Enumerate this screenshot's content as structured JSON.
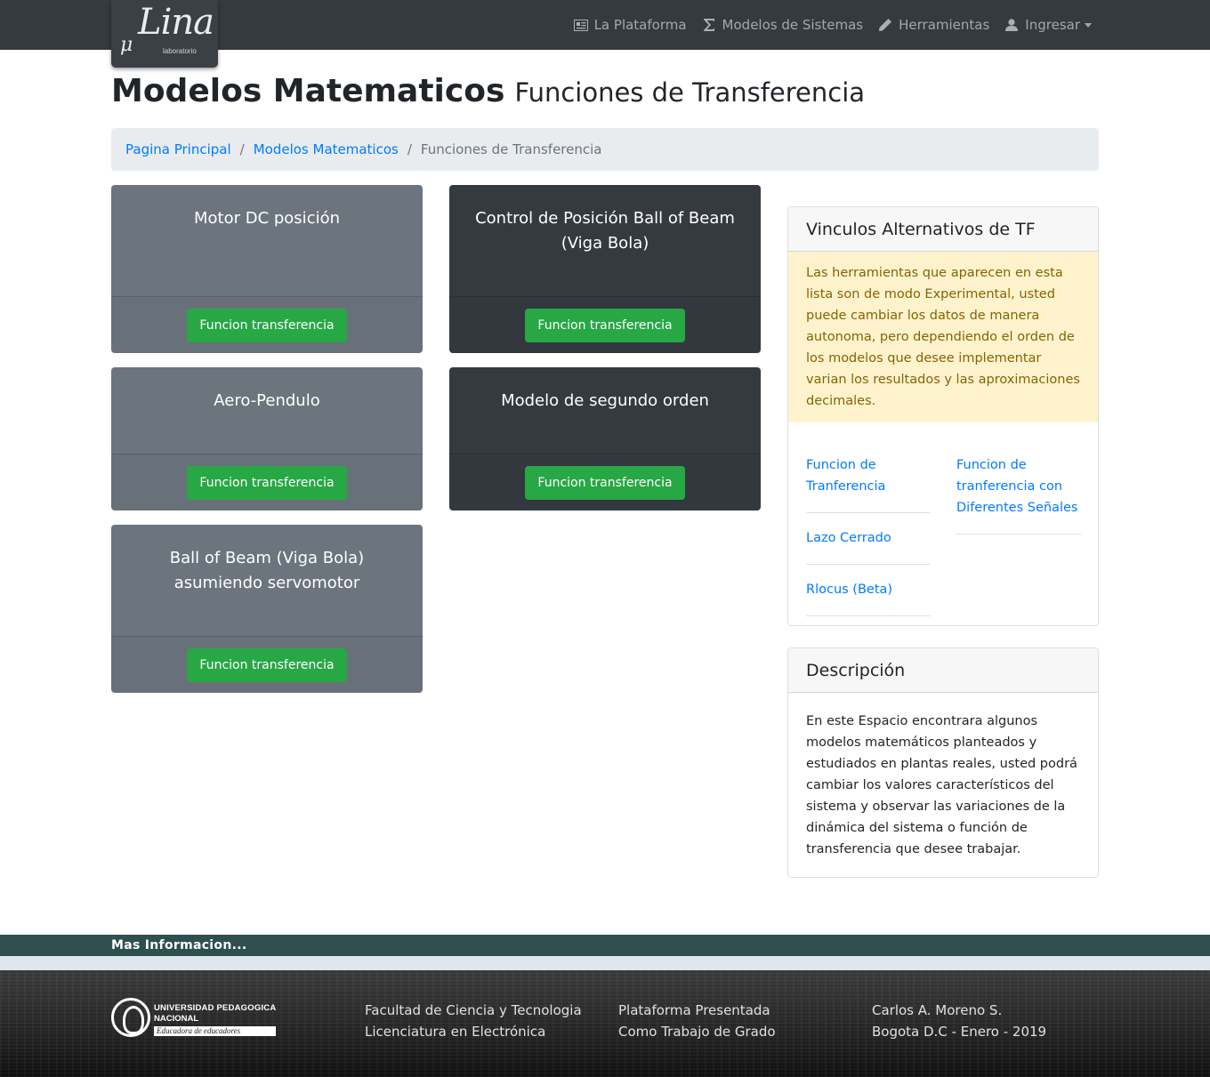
{
  "navbar": {
    "logo": {
      "mu": "μ",
      "name": "Lina",
      "sub": "laboratorio"
    },
    "links": [
      {
        "label": "La Plataforma",
        "icon": "newspaper-icon"
      },
      {
        "label": "Modelos de Sistemas",
        "icon": "sigma-icon"
      },
      {
        "label": "Herramientas",
        "icon": "pencil-icon"
      },
      {
        "label": "Ingresar",
        "icon": "user-icon",
        "dropdown": true
      }
    ]
  },
  "header": {
    "title": "Modelos Matematicos",
    "subtitle": "Funciones de Transferencia"
  },
  "breadcrumb": {
    "items": [
      "Pagina Principal",
      "Modelos Matematicos"
    ],
    "separator": "/",
    "active": "Funciones de Transferencia"
  },
  "cards": [
    {
      "title": "Motor DC posición",
      "button": "Funcion transferencia",
      "style": "grey"
    },
    {
      "title": "Control de Posición Ball of Beam (Viga Bola)",
      "button": "Funcion transferencia",
      "style": "dark"
    },
    {
      "title": "Aero-Pendulo",
      "button": "Funcion transferencia",
      "style": "grey"
    },
    {
      "title": "Modelo de segundo orden",
      "button": "Funcion transferencia",
      "style": "dark"
    },
    {
      "title": "Ball of Beam (Viga Bola) asumiendo servomotor",
      "button": "Funcion transferencia",
      "style": "grey"
    }
  ],
  "vinculos": {
    "title": "Vinculos Alternativos de TF",
    "warning": "Las herramientas que aparecen en esta lista son de modo Experimental, usted puede cambiar los datos de manera autonoma, pero dependiendo el orden de los modelos que desee implementar varian los resultados y las aproximaciones decimales.",
    "left_links": [
      "Funcion de Tranferencia",
      "Lazo Cerrado",
      "Rlocus (Beta)"
    ],
    "right_links": [
      "Funcion de tranferencia con Diferentes Señales"
    ]
  },
  "descripcion": {
    "title": "Descripción",
    "text": "En este Espacio encontrara algunos modelos matemáticos planteados y estudiados en plantas reales, usted podrá cambiar los valores característicos del sistema y observar las variaciones de la dinámica del sistema o función de transferencia que desee trabajar."
  },
  "footer": {
    "more_info": "Mas Informacion...",
    "logo": {
      "line1": "UNIVERSIDAD PEDAGOGICA",
      "line2": "NACIONAL",
      "line3": "Educadora de educadores"
    },
    "col1": [
      "Facultad de Ciencia y Tecnologia",
      "Licenciatura en Electrónica"
    ],
    "col2": [
      "Plataforma Presentada",
      "Como Trabajo de Grado"
    ],
    "col3": [
      "Carlos A. Moreno S.",
      "Bogota D.C - Enero - 2019"
    ]
  },
  "colors": {
    "navbar": "#343a40",
    "card_grey": "#6c757d",
    "card_dark": "#343a40",
    "button_green": "#28a745",
    "link_blue": "#007bff",
    "warning_bg": "#fff3cd",
    "more_bar": "#2f4f4f"
  }
}
